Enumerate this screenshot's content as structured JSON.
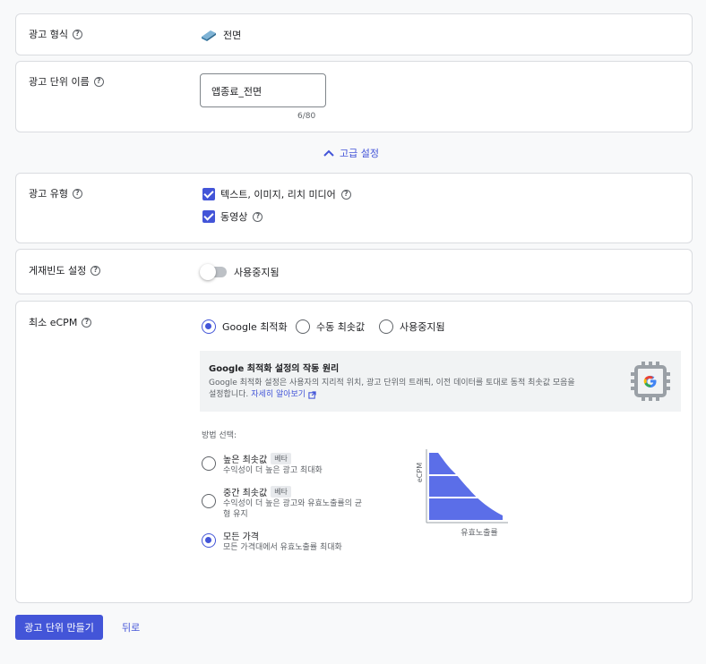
{
  "ad_format": {
    "label": "광고 형식",
    "value": "전면"
  },
  "ad_unit_name": {
    "label": "광고 단위 이름",
    "value": "앱종료_전면",
    "counter": "6/80"
  },
  "advanced_toggle": {
    "label": "고급 설정"
  },
  "ad_type": {
    "label": "광고 유형",
    "options": [
      {
        "label": "텍스트, 이미지, 리치 미디어",
        "checked": true
      },
      {
        "label": "동영상",
        "checked": true
      }
    ]
  },
  "frequency": {
    "label": "게재빈도 설정",
    "toggle_label": "사용중지됨"
  },
  "ecpm": {
    "label": "최소 eCPM",
    "options": [
      {
        "label": "Google 최적화",
        "selected": true
      },
      {
        "label": "수동 최솟값",
        "selected": false
      },
      {
        "label": "사용중지됨",
        "selected": false
      }
    ],
    "info_title": "Google 최적화 설정의 작동 원리",
    "info_text_1": "Google 최적화 설정은 사용자의 지리적 위치, 광고 단위의 트래픽, 이전 데이터를 토대로 동적 최솟값 모음을",
    "info_text_2": "설정합니다.",
    "info_link": "자세히 알아보기",
    "method_label": "방법 선택:",
    "methods": [
      {
        "title": "높은 최솟값",
        "badge": "베타",
        "desc_1": "수익성이 더 높은 광고 최대화",
        "desc_2": "",
        "selected": false
      },
      {
        "title": "중간 최솟값",
        "badge": "베타",
        "desc_1": "수익성이 더 높은 광고와 유효노출률의 균",
        "desc_2": "형 유지",
        "selected": false
      },
      {
        "title": "모든 가격",
        "badge": "",
        "desc_1": "모든 가격대에서 유효노출률 최대화",
        "desc_2": "",
        "selected": true
      }
    ],
    "chart_y_label": "eCPM",
    "chart_x_label": "유효노출률"
  },
  "actions": {
    "create_label": "광고 단위 만들기",
    "back_label": "뒤로"
  },
  "colors": {
    "accent": "#4355d8",
    "chart_fill": "#5b6ee8"
  }
}
